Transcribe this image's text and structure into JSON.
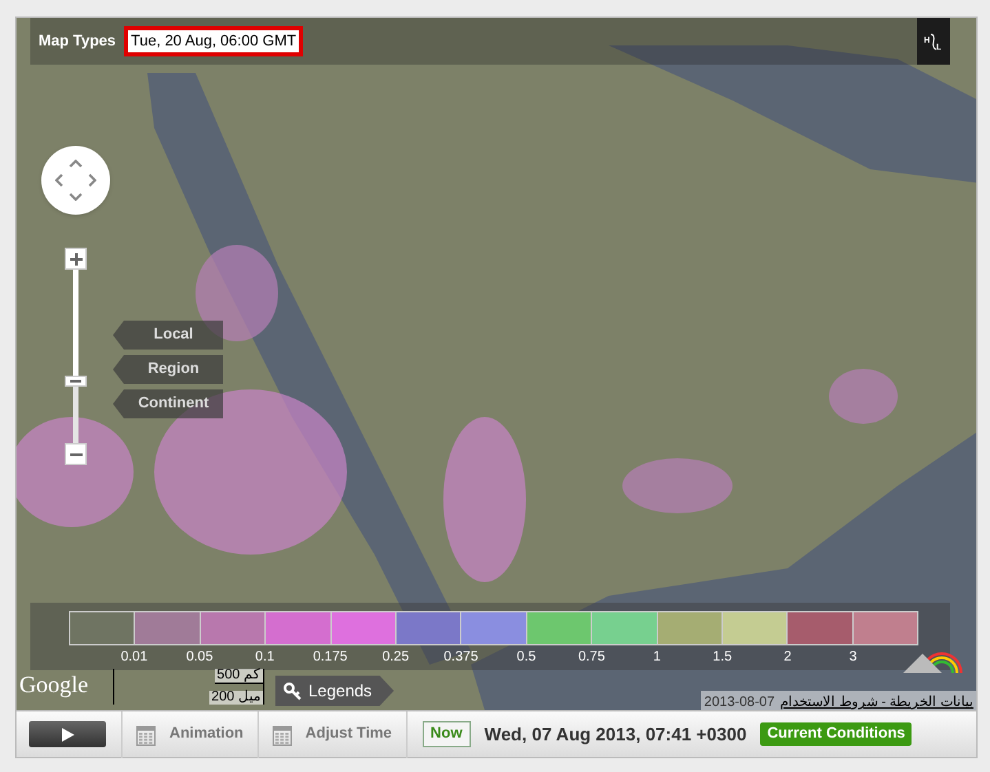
{
  "top_bar": {
    "map_types": "Map Types",
    "forecast_time": "Tue, 20 Aug, 06:00 GMT"
  },
  "high_low_button": {
    "high": "H",
    "low": "L"
  },
  "zoom_slider": {
    "level": 0.36
  },
  "view_buttons": [
    {
      "label": "Local"
    },
    {
      "label": "Region"
    },
    {
      "label": "Continent"
    }
  ],
  "legend": {
    "swatches": [
      {
        "color": "#6f7462"
      },
      {
        "color": "#a07b98"
      },
      {
        "color": "#b878ad"
      },
      {
        "color": "#d46ecf"
      },
      {
        "color": "#de70de"
      },
      {
        "color": "#7b78c8"
      },
      {
        "color": "#8a8ee0"
      },
      {
        "color": "#6dc76e"
      },
      {
        "color": "#77d08f"
      },
      {
        "color": "#a5ad73"
      },
      {
        "color": "#c4cc92"
      },
      {
        "color": "#a65c6c"
      },
      {
        "color": "#c07f8e"
      }
    ],
    "labels": [
      "0.01",
      "0.05",
      "0.1",
      "0.175",
      "0.25",
      "0.375",
      "0.5",
      "0.75",
      "1",
      "1.5",
      "2",
      "3"
    ]
  },
  "map_footer": {
    "provider": "Google",
    "scale_km": "500 كم",
    "scale_mi": "200 ميل",
    "legends_button": "Legends",
    "map_date": "2013-08-07",
    "terms": "بيانات الخريطة - شروط الاستخدام"
  },
  "toolbar": {
    "animation": "Animation",
    "adjust_time": "Adjust Time",
    "now": "Now",
    "current_time": "Wed, 07 Aug 2013, 07:41 +0300",
    "current_conditions": "Current Conditions"
  }
}
